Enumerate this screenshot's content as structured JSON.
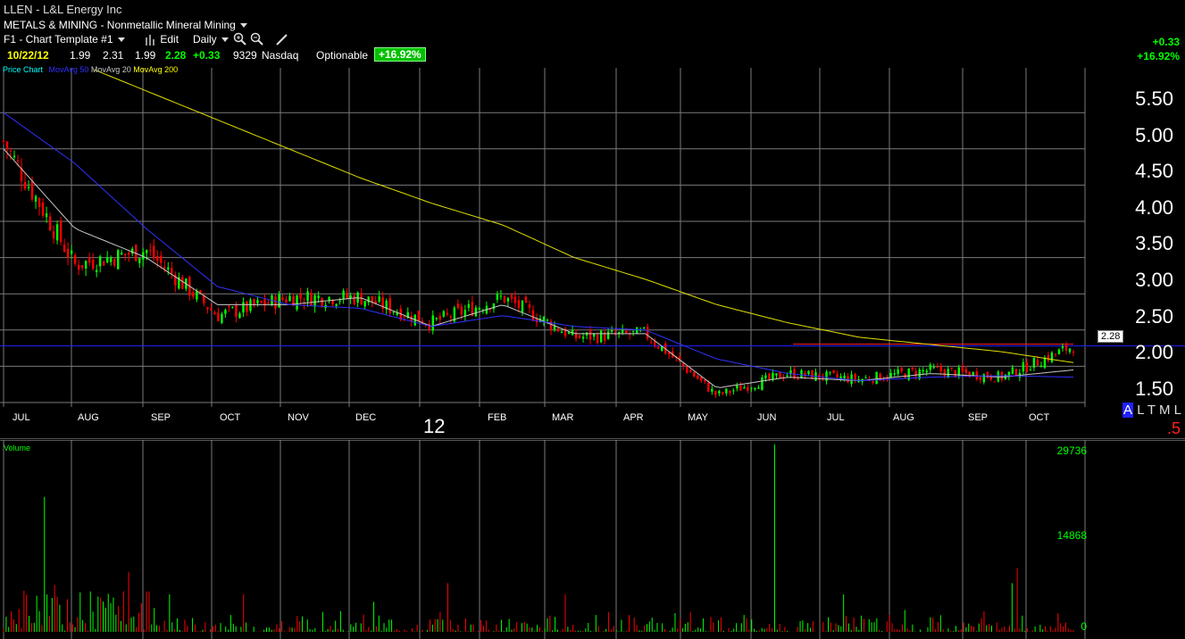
{
  "header": {
    "symbol_title": "LLEN - L&L Energy Inc",
    "industry": "METALS & MINING - Nonmetallic Mineral Mining",
    "template_label": "F1 - Chart Template #1",
    "edit_label": "Edit",
    "period_label": "Daily",
    "quote": {
      "date": "10/22/12",
      "open": "1.99",
      "high": "2.31",
      "low": "1.99",
      "last": "2.28",
      "change": "+0.33",
      "volume": "9329",
      "exchange": "Nasdaq",
      "optionable": "Optionable",
      "pct_change": "+16.92%"
    },
    "right_change": "+0.33",
    "right_pct": "+16.92%"
  },
  "legend": {
    "price_chart": "Price Chart",
    "ma50": "MovAvg 50",
    "ma20": "MovAvg 20",
    "ma200": "MovAvg 200"
  },
  "price_axis": [
    "5.50",
    "5.00",
    "4.50",
    "4.00",
    "3.50",
    "3.00",
    "2.50",
    "2.00",
    "1.50"
  ],
  "current_price_tag": "2.28",
  "months": [
    "JUL",
    "AUG",
    "SEP",
    "OCT",
    "NOV",
    "DEC",
    "FEB",
    "MAR",
    "APR",
    "MAY",
    "JUN",
    "JUL",
    "AUG",
    "SEP",
    "OCT"
  ],
  "year_label": "12",
  "right_tools": {
    "a": "A",
    "l": "L",
    "t": "T",
    "m": "M",
    "l2": "L",
    "half": ".5"
  },
  "volume_panel": {
    "title": "Volume",
    "ticks": [
      "29736",
      "14868",
      "0"
    ]
  },
  "colors": {
    "up": "#00ff00",
    "down": "#ff0000",
    "ma20": "#c8c8c8",
    "ma50": "#3030ff",
    "ma200": "#e0e000",
    "grid": "#7a7a7a"
  },
  "chart_data": {
    "type": "line",
    "title": "LLEN - L&L Energy Inc",
    "ylabel": "",
    "xlabel": "",
    "ylim": [
      1.5,
      5.5
    ],
    "x": [
      "JUL",
      "AUG",
      "SEP",
      "OCT",
      "NOV",
      "DEC",
      "12",
      "FEB",
      "MAR",
      "APR",
      "MAY",
      "JUN",
      "JUL",
      "AUG",
      "SEP",
      "OCT"
    ],
    "series": [
      {
        "name": "Price Chart",
        "values": [
          5.1,
          3.4,
          3.6,
          2.7,
          2.95,
          2.95,
          2.6,
          2.95,
          2.4,
          2.45,
          1.6,
          1.9,
          1.82,
          1.95,
          1.85,
          2.28
        ]
      },
      {
        "name": "MovAvg 20",
        "values": [
          5.0,
          3.9,
          3.5,
          2.85,
          2.85,
          2.95,
          2.55,
          2.85,
          2.45,
          2.45,
          1.7,
          1.85,
          1.8,
          1.9,
          1.85,
          1.95
        ]
      },
      {
        "name": "MovAvg 50",
        "values": [
          5.5,
          4.8,
          3.9,
          3.1,
          2.85,
          2.8,
          2.55,
          2.7,
          2.55,
          2.5,
          2.1,
          1.9,
          1.8,
          1.85,
          1.87,
          1.85
        ]
      },
      {
        "name": "MovAvg 200",
        "values": [
          6.5,
          6.2,
          5.8,
          5.4,
          5.0,
          4.6,
          4.25,
          3.95,
          3.5,
          3.2,
          2.85,
          2.6,
          2.4,
          2.3,
          2.2,
          2.05
        ]
      }
    ],
    "volume_max": 29736,
    "grid": true
  }
}
